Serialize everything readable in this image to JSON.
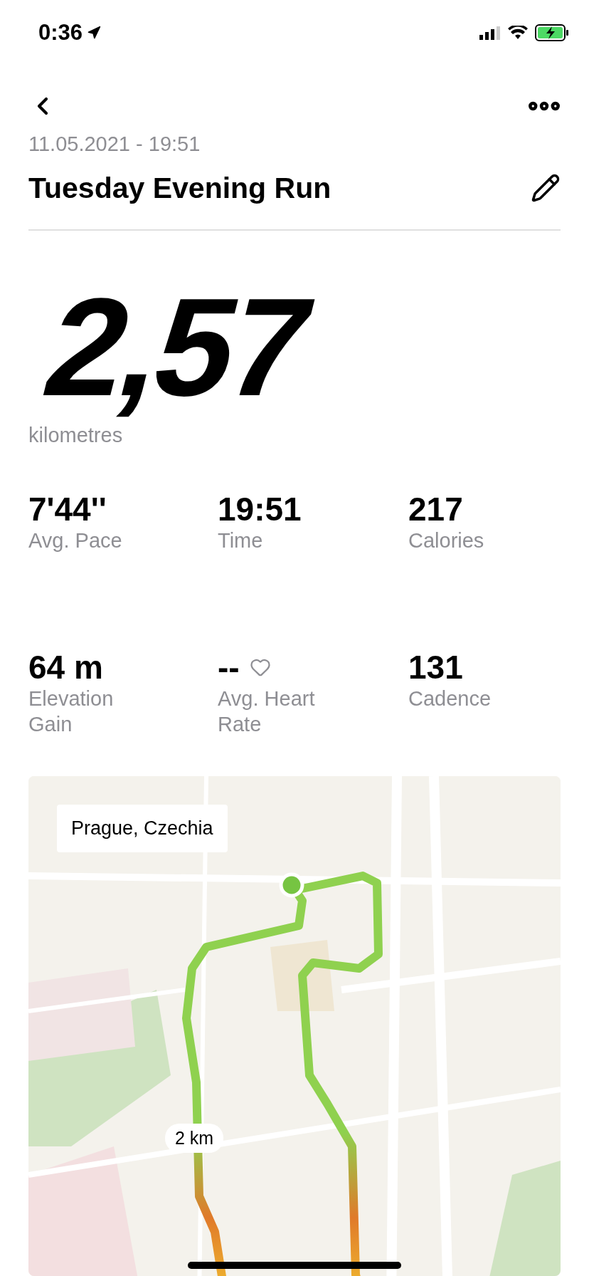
{
  "status_bar": {
    "time": "0:36"
  },
  "header": {
    "date": "11.05.2021 - 19:51",
    "title": "Tuesday Evening Run"
  },
  "distance": {
    "value": "2,57",
    "unit": "kilometres"
  },
  "stats": [
    {
      "value": "7'44''",
      "label": "Avg. Pace",
      "kind": "plain"
    },
    {
      "value": "19:51",
      "label": "Time",
      "kind": "plain"
    },
    {
      "value": "217",
      "label": "Calories",
      "kind": "plain"
    },
    {
      "value": "64 m",
      "label": "Elevation Gain",
      "kind": "plain"
    },
    {
      "value": "--",
      "label": "Avg. Heart Rate",
      "kind": "heart"
    },
    {
      "value": "131",
      "label": "Cadence",
      "kind": "plain"
    }
  ],
  "map": {
    "location": "Prague, Czechia",
    "marker": "2 km"
  }
}
